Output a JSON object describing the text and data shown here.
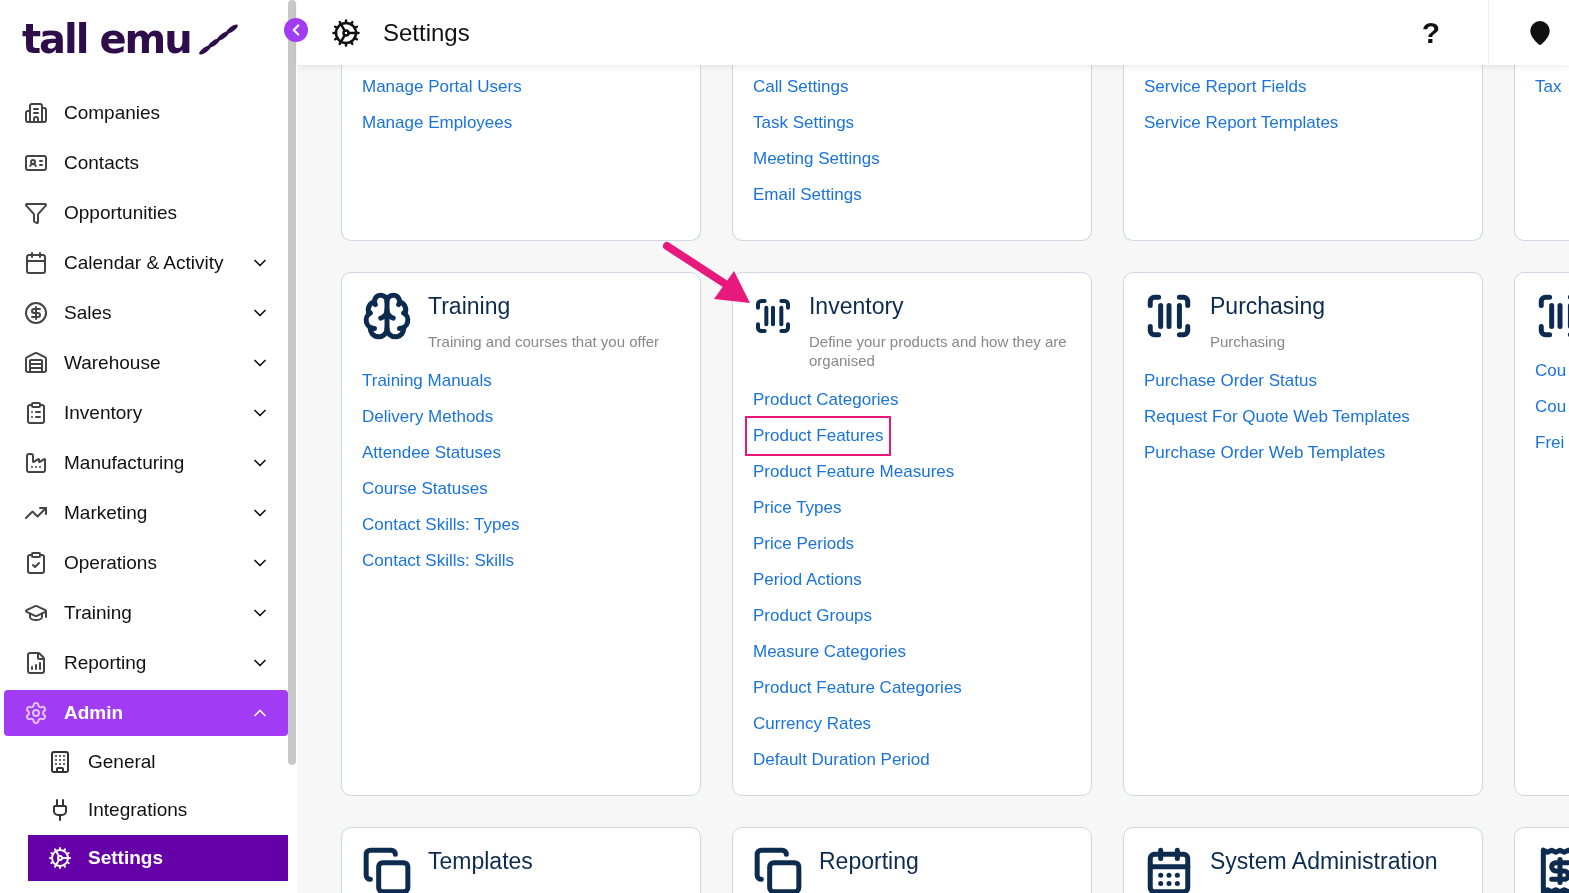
{
  "sidebar": {
    "logo": "tall emu",
    "items": [
      {
        "label": "Companies",
        "kind": "plain",
        "selected": false
      },
      {
        "label": "Contacts",
        "kind": "plain",
        "selected": false
      },
      {
        "label": "Opportunities",
        "kind": "plain",
        "selected": false
      },
      {
        "label": "Calendar & Activity",
        "kind": "group",
        "expanded": false,
        "selected": false
      },
      {
        "label": "Sales",
        "kind": "group",
        "expanded": false,
        "selected": false
      },
      {
        "label": "Warehouse",
        "kind": "group",
        "expanded": false,
        "selected": false
      },
      {
        "label": "Inventory",
        "kind": "group",
        "expanded": false,
        "selected": false
      },
      {
        "label": "Manufacturing",
        "kind": "group",
        "expanded": false,
        "selected": false
      },
      {
        "label": "Marketing",
        "kind": "group",
        "expanded": false,
        "selected": false
      },
      {
        "label": "Operations",
        "kind": "group",
        "expanded": false,
        "selected": false
      },
      {
        "label": "Training",
        "kind": "group",
        "expanded": false,
        "selected": false
      },
      {
        "label": "Reporting",
        "kind": "group",
        "expanded": false,
        "selected": false
      },
      {
        "label": "Admin",
        "kind": "group",
        "expanded": true,
        "selected": true,
        "children": [
          {
            "label": "General",
            "selected": false
          },
          {
            "label": "Integrations",
            "selected": false
          },
          {
            "label": "Settings",
            "selected": true
          }
        ]
      }
    ]
  },
  "header": {
    "title": "Settings",
    "help": "?"
  },
  "rows": [
    {
      "cut_top": true,
      "cards": [
        {
          "kind": "links",
          "links": [
            {
              "label": "Manage Portal Users",
              "highlighted": false
            },
            {
              "label": "Manage Employees",
              "highlighted": false
            }
          ]
        },
        {
          "kind": "links",
          "links": [
            {
              "label": "Call Settings",
              "highlighted": false
            },
            {
              "label": "Task Settings",
              "highlighted": false
            },
            {
              "label": "Meeting Settings",
              "highlighted": false
            },
            {
              "label": "Email Settings",
              "highlighted": false
            }
          ]
        },
        {
          "kind": "links",
          "links": [
            {
              "label": "Service Report Fields",
              "highlighted": false
            },
            {
              "label": "Service Report Templates",
              "highlighted": false
            }
          ]
        },
        {
          "kind": "links",
          "links": [
            {
              "label": "Tax",
              "highlighted": false
            }
          ]
        }
      ]
    },
    {
      "cut_top": false,
      "cards": [
        {
          "kind": "full",
          "title": "Training",
          "subtitle": "Training and courses that you offer",
          "links": [
            {
              "label": "Training Manuals",
              "highlighted": false
            },
            {
              "label": "Delivery Methods",
              "highlighted": false
            },
            {
              "label": "Attendee Statuses",
              "highlighted": false
            },
            {
              "label": "Course Statuses",
              "highlighted": false
            },
            {
              "label": "Contact Skills: Types",
              "highlighted": false
            },
            {
              "label": "Contact Skills: Skills",
              "highlighted": false
            }
          ]
        },
        {
          "kind": "full",
          "title": "Inventory",
          "subtitle": "Define your products and how they are organised",
          "arrow": true,
          "links": [
            {
              "label": "Product Categories",
              "highlighted": false
            },
            {
              "label": "Product Features",
              "highlighted": true
            },
            {
              "label": "Product Feature Measures",
              "highlighted": false
            },
            {
              "label": "Price Types",
              "highlighted": false
            },
            {
              "label": "Price Periods",
              "highlighted": false
            },
            {
              "label": "Period Actions",
              "highlighted": false
            },
            {
              "label": "Product Groups",
              "highlighted": false
            },
            {
              "label": "Measure Categories",
              "highlighted": false
            },
            {
              "label": "Product Feature Categories",
              "highlighted": false
            },
            {
              "label": "Currency Rates",
              "highlighted": false
            },
            {
              "label": "Default Duration Period",
              "highlighted": false
            }
          ]
        },
        {
          "kind": "full",
          "title": "Purchasing",
          "subtitle": "Purchasing",
          "links": [
            {
              "label": "Purchase Order Status",
              "highlighted": false
            },
            {
              "label": "Request For Quote Web Templates",
              "highlighted": false
            },
            {
              "label": "Purchase Order Web Templates",
              "highlighted": false
            }
          ]
        },
        {
          "kind": "full",
          "links": [
            {
              "label": "Cou",
              "highlighted": false
            },
            {
              "label": "Cou",
              "highlighted": false
            },
            {
              "label": "Frei",
              "highlighted": false
            }
          ]
        }
      ]
    },
    {
      "cut_top": false,
      "cards": [
        {
          "kind": "full",
          "title": "Templates"
        },
        {
          "kind": "full",
          "title": "Reporting"
        },
        {
          "kind": "full",
          "title": "System Administration"
        },
        {
          "kind": "icon_only"
        }
      ]
    }
  ]
}
